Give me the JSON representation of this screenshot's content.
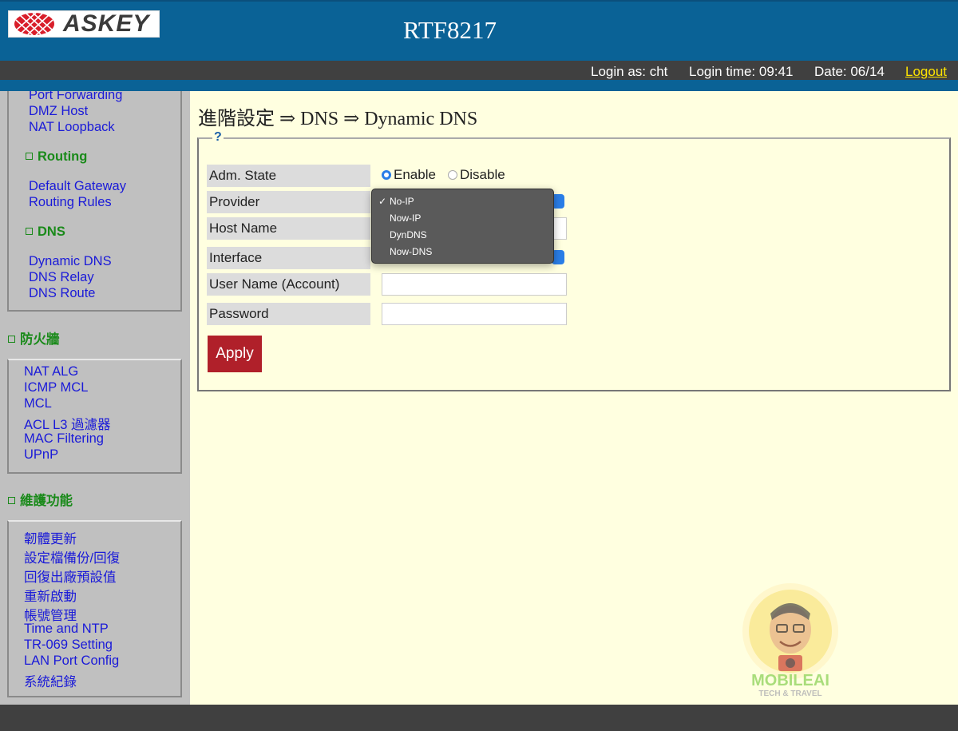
{
  "header": {
    "logo_text": "ASKEY",
    "model": "RTF8217"
  },
  "status": {
    "login_as": "Login as: cht",
    "login_time": "Login time: 09:41",
    "date": "Date: 06/14",
    "logout": "Logout"
  },
  "sidebar": {
    "nat_links": [
      "Port Forwarding",
      "DMZ Host",
      "NAT Loopback"
    ],
    "routing_head": "Routing",
    "routing_links": [
      "Default Gateway",
      "Routing Rules"
    ],
    "dns_head": "DNS",
    "dns_links": [
      "Dynamic DNS",
      "DNS Relay",
      "DNS Route"
    ],
    "firewall_head": "防火牆",
    "firewall_links": [
      "NAT ALG",
      "ICMP MCL",
      "MCL",
      "ACL L3 過濾器",
      "MAC Filtering",
      "UPnP"
    ],
    "maint_head": "維護功能",
    "maint_links": [
      "韌體更新",
      "設定檔備份/回復",
      "回復出廠預設值",
      "重新啟動",
      "帳號管理",
      "Time and NTP",
      "TR-069 Setting",
      "LAN Port Config",
      "系統紀錄"
    ]
  },
  "main": {
    "breadcrumb": "進階設定 ⇒ DNS ⇒ Dynamic DNS",
    "help": "?",
    "labels": {
      "adm_state": "Adm. State",
      "provider": "Provider",
      "host_name": "Host Name",
      "interface": "Interface",
      "user_name": "User Name (Account)",
      "password": "Password"
    },
    "radio": {
      "enable": "Enable",
      "disable": "Disable",
      "selected": "Enable"
    },
    "apply": "Apply",
    "provider_options": [
      "No-IP",
      "Now-IP",
      "DynDNS",
      "Now-DNS"
    ],
    "provider_selected": "No-IP",
    "check": "✓"
  },
  "watermark": {
    "name": "MOBILEAI",
    "tagline": "TECH & TRAVEL"
  },
  "colors": {
    "header_blue": "#0a6296",
    "apply_red": "#b0202a",
    "content_bg": "#ffffe0",
    "sidebar_bg": "#c0c0c0"
  }
}
